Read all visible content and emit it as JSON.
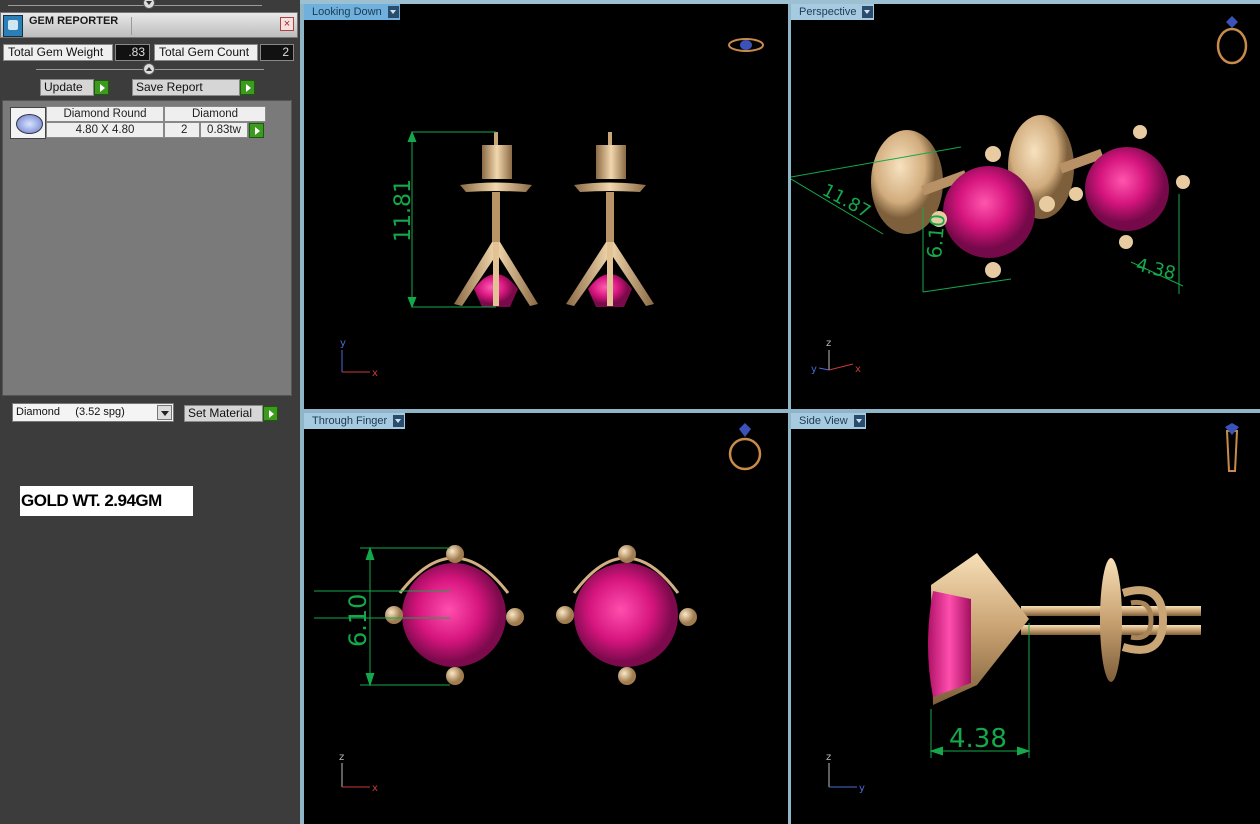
{
  "panel": {
    "title": "GEM REPORTER",
    "close_label": "×",
    "total_gem_weight_label": "Total Gem Weight",
    "total_gem_weight_value": ".83",
    "total_gem_count_label": "Total Gem Count",
    "total_gem_count_value": "2",
    "update_label": "Update",
    "save_report_label": "Save Report"
  },
  "gem_list": {
    "rows": [
      {
        "shape": "Diamond Round",
        "material": "Diamond",
        "size": "4.80 X 4.80",
        "count": "2",
        "weight": "0.83tw"
      }
    ]
  },
  "material": {
    "selected": "Diamond     (3.52 spg)",
    "set_label": "Set Material"
  },
  "note": "GOLD WT. 2.94GM",
  "viewports": {
    "top_left": {
      "label": "Looking Down",
      "dimension": "11.81",
      "axis_x": "x",
      "axis_y": "y",
      "icon": "ring-top-icon"
    },
    "top_right": {
      "label": "Perspective",
      "dimension_a": "11.87",
      "dimension_b": "6.10",
      "dimension_c": "4.38",
      "axis_x": "x",
      "axis_y": "y",
      "axis_z": "z",
      "icon": "ring-perspective-icon"
    },
    "bottom_left": {
      "label": "Through Finger",
      "dimension": "6.10",
      "axis_x": "x",
      "axis_z": "z",
      "icon": "ring-front-icon"
    },
    "bottom_right": {
      "label": "Side View",
      "dimension": "4.38",
      "axis_y": "y",
      "axis_z": "z",
      "icon": "ring-side-icon"
    }
  },
  "colors": {
    "gold": "#d9b78c",
    "gem": "#d6157e",
    "dimension": "#14a84a",
    "viewport_bg": "#000000"
  }
}
